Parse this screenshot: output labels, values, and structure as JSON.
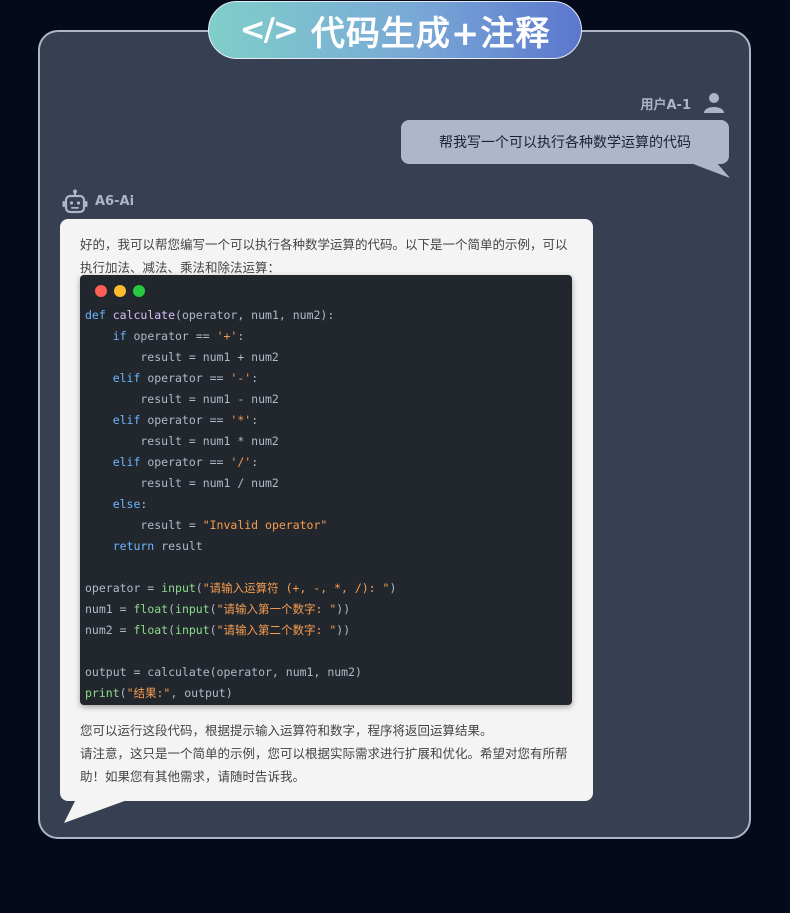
{
  "banner": {
    "icon": "</>",
    "title": "代码生成+注释"
  },
  "user": {
    "name": "用户A-1",
    "avatar_icon": "user-icon",
    "message": "帮我写一个可以执行各种数学运算的代码"
  },
  "ai": {
    "name": "A6-Ai",
    "avatar_icon": "robot-icon",
    "intro": "好的，我可以帮您编写一个可以执行各种数学运算的代码。以下是一个简单的示例，可以执行加法、减法、乘法和除法运算：",
    "code_lines": [
      [
        {
          "t": "def ",
          "c": "kw"
        },
        {
          "t": "calculate",
          "c": "fn"
        },
        {
          "t": "(operator, num1, num2):",
          "c": ""
        }
      ],
      [
        {
          "t": "    if ",
          "c": "kw"
        },
        {
          "t": "operator == ",
          "c": ""
        },
        {
          "t": "'+'",
          "c": "str"
        },
        {
          "t": ":",
          "c": ""
        }
      ],
      [
        {
          "t": "        result = num1 + num2",
          "c": ""
        }
      ],
      [
        {
          "t": "    elif ",
          "c": "kw"
        },
        {
          "t": "operator == ",
          "c": ""
        },
        {
          "t": "'-'",
          "c": "str"
        },
        {
          "t": ":",
          "c": ""
        }
      ],
      [
        {
          "t": "        result = num1 - num2",
          "c": ""
        }
      ],
      [
        {
          "t": "    elif ",
          "c": "kw"
        },
        {
          "t": "operator == ",
          "c": ""
        },
        {
          "t": "'*'",
          "c": "str"
        },
        {
          "t": ":",
          "c": ""
        }
      ],
      [
        {
          "t": "        result = num1 * num2",
          "c": ""
        }
      ],
      [
        {
          "t": "    elif ",
          "c": "kw"
        },
        {
          "t": "operator == ",
          "c": ""
        },
        {
          "t": "'/'",
          "c": "str"
        },
        {
          "t": ":",
          "c": ""
        }
      ],
      [
        {
          "t": "        result = num1 / num2",
          "c": ""
        }
      ],
      [
        {
          "t": "    else",
          "c": "kw"
        },
        {
          "t": ":",
          "c": ""
        }
      ],
      [
        {
          "t": "        result = ",
          "c": ""
        },
        {
          "t": "\"Invalid operator\"",
          "c": "str"
        }
      ],
      [
        {
          "t": "    return ",
          "c": "kw"
        },
        {
          "t": "result",
          "c": ""
        }
      ],
      [],
      [
        {
          "t": "operator = ",
          "c": ""
        },
        {
          "t": "input",
          "c": "bi"
        },
        {
          "t": "(",
          "c": ""
        },
        {
          "t": "\"请输入运算符 (+, -, *, /): \"",
          "c": "str"
        },
        {
          "t": ")",
          "c": ""
        }
      ],
      [
        {
          "t": "num1 = ",
          "c": ""
        },
        {
          "t": "float",
          "c": "bi"
        },
        {
          "t": "(",
          "c": ""
        },
        {
          "t": "input",
          "c": "bi"
        },
        {
          "t": "(",
          "c": ""
        },
        {
          "t": "\"请输入第一个数字: \"",
          "c": "str"
        },
        {
          "t": "))",
          "c": ""
        }
      ],
      [
        {
          "t": "num2 = ",
          "c": ""
        },
        {
          "t": "float",
          "c": "bi"
        },
        {
          "t": "(",
          "c": ""
        },
        {
          "t": "input",
          "c": "bi"
        },
        {
          "t": "(",
          "c": ""
        },
        {
          "t": "\"请输入第二个数字: \"",
          "c": "str"
        },
        {
          "t": "))",
          "c": ""
        }
      ],
      [],
      [
        {
          "t": "output = calculate(operator, num1, num2)",
          "c": ""
        }
      ],
      [
        {
          "t": "print",
          "c": "bi"
        },
        {
          "t": "(",
          "c": ""
        },
        {
          "t": "\"结果:\"",
          "c": "str"
        },
        {
          "t": ", output)",
          "c": ""
        }
      ]
    ],
    "outro_1": "您可以运行这段代码，根据提示输入运算符和数字，程序将返回运算结果。",
    "outro_2": "请注意，这只是一个简单的示例，您可以根据实际需求进行扩展和优化。希望对您有所帮助！如果您有其他需求，请随时告诉我。"
  },
  "colors": {
    "background": "#050a1b",
    "panel": "#373f53",
    "panel_border": "#aeb5c8",
    "user_bubble": "#aeb6cb",
    "ai_bubble": "#f4f4f4",
    "code_bg": "#22272e",
    "dot_red": "#ff5f57",
    "dot_yellow": "#febc2e",
    "dot_green": "#28c840"
  }
}
